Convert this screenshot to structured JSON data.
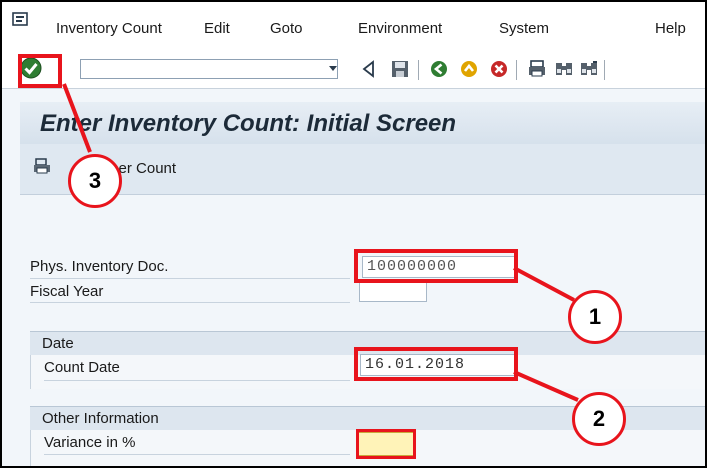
{
  "menu": {
    "items": [
      {
        "label": "Inventory Count"
      },
      {
        "label": "Edit"
      },
      {
        "label": "Goto"
      },
      {
        "label": "Environment"
      },
      {
        "label": "System"
      },
      {
        "label": "Help"
      }
    ]
  },
  "toolbar": {
    "command_value": "",
    "icons": [
      "enter-icon",
      "back-triangle-icon",
      "save-icon",
      "back-icon",
      "exit-icon",
      "cancel-icon",
      "print-icon",
      "find-icon",
      "find-next-icon"
    ]
  },
  "title": "Enter Inventory Count: Initial Screen",
  "app_toolbar": {
    "other_count_label": "Other Count",
    "other_count_partial": "ther Count"
  },
  "form": {
    "phys_doc_label": "Phys. Inventory Doc.",
    "phys_doc_value": "100000000",
    "fiscal_year_label": "Fiscal Year",
    "fiscal_year_value": "",
    "date_group_title": "Date",
    "count_date_label": "Count Date",
    "count_date_value": "16.01.2018",
    "other_info_title": "Other Information",
    "variance_label": "Variance in %",
    "variance_value": ""
  },
  "callouts": [
    "1",
    "2",
    "3"
  ],
  "colors": {
    "highlight": "#e8141c",
    "title_text": "#1c2a38",
    "required_field": "#fff3b8"
  }
}
